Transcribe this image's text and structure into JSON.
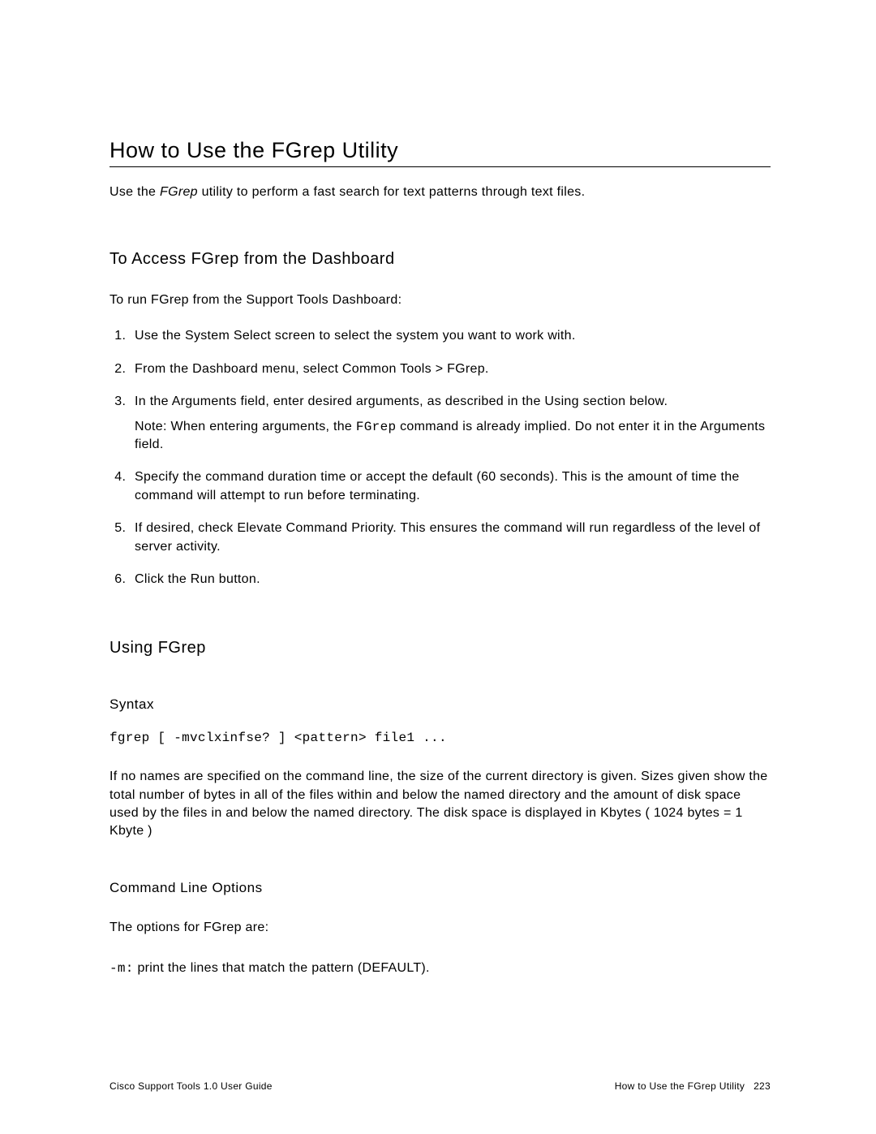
{
  "h1": "How to Use the FGrep Utility",
  "intro_prefix": "Use the ",
  "intro_em": "FGrep",
  "intro_suffix": " utility to perform a fast search for text patterns through text files.",
  "section1": {
    "heading": "To Access FGrep from the Dashboard",
    "lead": "To run FGrep from the Support Tools Dashboard:",
    "steps": [
      "Use the System Select screen to select the system you want to work with.",
      "From the Dashboard menu, select Common Tools > FGrep.",
      "In the Arguments field, enter desired arguments, as described in the Using section below.",
      "Specify the command duration time or accept the default (60 seconds). This is the amount of time the command will attempt to run before terminating.",
      "If desired, check Elevate Command Priority. This ensures the command will run regardless of the level of server activity.",
      "Click the Run button."
    ],
    "note_prefix": "Note: When entering arguments, the ",
    "note_mono": "FGrep",
    "note_suffix": " command is already implied. Do not enter it in the Arguments field."
  },
  "section2": {
    "heading": "Using FGrep",
    "syntax_heading": "Syntax",
    "syntax_line": "fgrep [ -mvclxinfse? ] <pattern> file1 ...",
    "syntax_desc": "If no names are specified on the command line, the size of the current directory is given. Sizes given show the total number of bytes in all of the files within and below the named directory and the amount of disk space used by the files in and below the named directory. The disk space is displayed in Kbytes ( 1024 bytes = 1 Kbyte )",
    "opts_heading": "Command Line Options",
    "opts_lead": "The options for FGrep are:",
    "opt_m_flag": "-m:",
    "opt_m_desc": " print the lines that match the pattern (DEFAULT)."
  },
  "footer": {
    "left": "Cisco Support Tools 1.0 User Guide",
    "right_text": "How to Use the FGrep Utility",
    "right_page": "223"
  }
}
